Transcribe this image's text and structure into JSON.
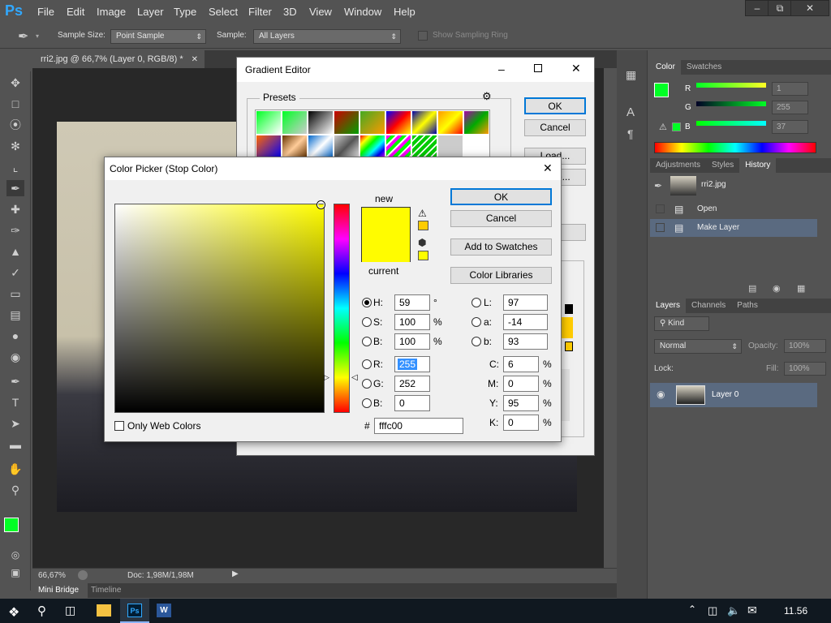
{
  "app": {
    "logo": "Ps"
  },
  "menu": [
    "File",
    "Edit",
    "Image",
    "Layer",
    "Type",
    "Select",
    "Filter",
    "3D",
    "View",
    "Window",
    "Help"
  ],
  "options": {
    "sample_size_label": "Sample Size:",
    "sample_size_value": "Point Sample",
    "sample_label": "Sample:",
    "sample_value": "All Layers",
    "show_ring_label": "Show Sampling Ring"
  },
  "document": {
    "tab_title": "rri2.jpg @ 66,7% (Layer 0, RGB/8) *",
    "zoom": "66,67%",
    "doc_size": "Doc: 1,98M/1,98M"
  },
  "bottom_tabs": [
    "Mini Bridge",
    "Timeline"
  ],
  "color_panel": {
    "tabs": [
      "Color",
      "Swatches"
    ],
    "r_label": "R",
    "g_label": "G",
    "b_label": "B",
    "r": "1",
    "g": "255",
    "b": "37",
    "foreground": "#00ff25"
  },
  "adjust_tabs": [
    "Adjustments",
    "Styles",
    "History"
  ],
  "history": {
    "snapshot": "rri2.jpg",
    "items": [
      "Open",
      "Make Layer"
    ]
  },
  "layers_panel": {
    "tabs": [
      "Layers",
      "Channels",
      "Paths"
    ],
    "kind": "Kind",
    "blend": "Normal",
    "opacity_label": "Opacity:",
    "opacity": "100%",
    "lock_label": "Lock:",
    "fill_label": "Fill:",
    "fill": "100%",
    "layer_name": "Layer 0"
  },
  "gradient_editor": {
    "title": "Gradient Editor",
    "presets_label": "Presets",
    "ok": "OK",
    "cancel": "Cancel",
    "load": "Load...",
    "save": "Save..."
  },
  "color_picker": {
    "title": "Color Picker (Stop Color)",
    "new_label": "new",
    "current_label": "current",
    "ok": "OK",
    "cancel": "Cancel",
    "add_swatches": "Add to Swatches",
    "color_libraries": "Color Libraries",
    "only_web": "Only Web Colors",
    "hsb": [
      {
        "label": "H:",
        "value": "59",
        "unit": "°"
      },
      {
        "label": "S:",
        "value": "100",
        "unit": "%"
      },
      {
        "label": "B:",
        "value": "100",
        "unit": "%"
      }
    ],
    "rgb": [
      {
        "label": "R:",
        "value": "255"
      },
      {
        "label": "G:",
        "value": "252"
      },
      {
        "label": "B:",
        "value": "0"
      }
    ],
    "lab": [
      {
        "label": "L:",
        "value": "97"
      },
      {
        "label": "a:",
        "value": "-14"
      },
      {
        "label": "b:",
        "value": "93"
      }
    ],
    "cmyk": [
      {
        "label": "C:",
        "value": "6",
        "unit": "%"
      },
      {
        "label": "M:",
        "value": "0",
        "unit": "%"
      },
      {
        "label": "Y:",
        "value": "95",
        "unit": "%"
      },
      {
        "label": "K:",
        "value": "0",
        "unit": "%"
      }
    ],
    "hex_label": "#",
    "hex": "fffc00",
    "new_color": "#fffc00",
    "current_color": "#fffc00"
  },
  "taskbar": {
    "time": "11.56"
  }
}
